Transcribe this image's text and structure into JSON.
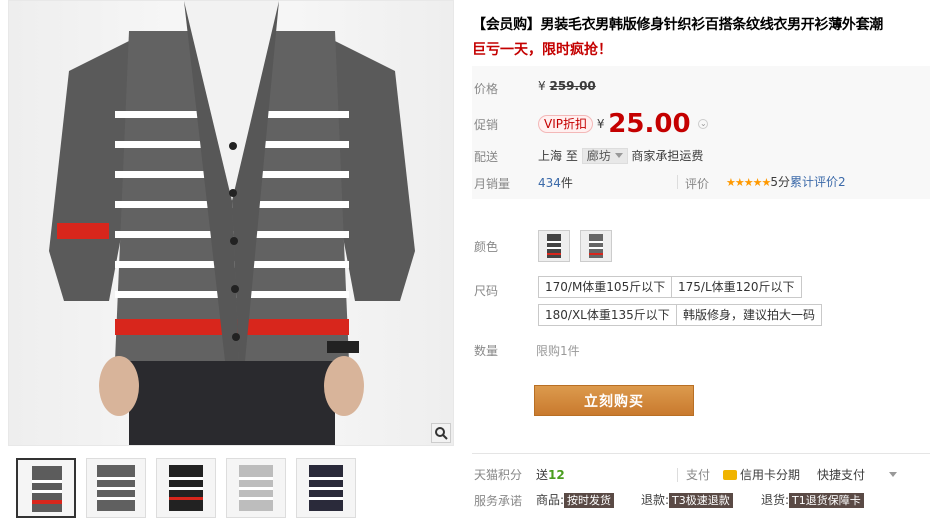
{
  "product": {
    "title": "【会员购】男装毛衣男韩版修身针织衫百搭条纹线衣男开衫薄外套潮",
    "subtitle": "巨亏一天，限时疯抢！"
  },
  "price": {
    "label": "价格",
    "currency": "¥",
    "original": "259.00"
  },
  "promo": {
    "label": "促销",
    "badge": "VIP折扣",
    "currency": "¥",
    "value": "25.00"
  },
  "shipping": {
    "label": "配送",
    "from": "上海",
    "to_word": "至",
    "city": "廊坊",
    "fee": "商家承担运费"
  },
  "sales": {
    "label": "月销量",
    "count": "434",
    "unit": "件",
    "rating_label": "评价",
    "stars": "★★★★★",
    "score": "5分",
    "review_text": "累计评价",
    "review_count": "2"
  },
  "sku": {
    "color_label": "颜色",
    "size_label": "尺码",
    "sizes": [
      "170/M体重105斤以下",
      "175/L体重120斤以下",
      "180/XL体重135斤以下",
      "韩版修身，建议拍大一码"
    ],
    "qty_label": "数量",
    "qty_limit": "限购1件"
  },
  "buy_button": "立刻购买",
  "footer": {
    "points_label": "天猫积分",
    "points_prefix": "送",
    "points": "12",
    "pay_label": "支付",
    "credit_card": "信用卡分期",
    "quick_pay": "快捷支付",
    "service_label": "服务承诺",
    "goods_label": "商品:",
    "goods_tag": "按时发货",
    "refund_label": "退款:",
    "refund_tag": "T3极速退款",
    "return_label": "退货:",
    "return_tag": "T1退货保障卡"
  },
  "colors": {
    "price_red": "#c40000",
    "buy_button": "#d1883a",
    "star": "#ff9900",
    "link_blue": "#3c6aa9"
  }
}
